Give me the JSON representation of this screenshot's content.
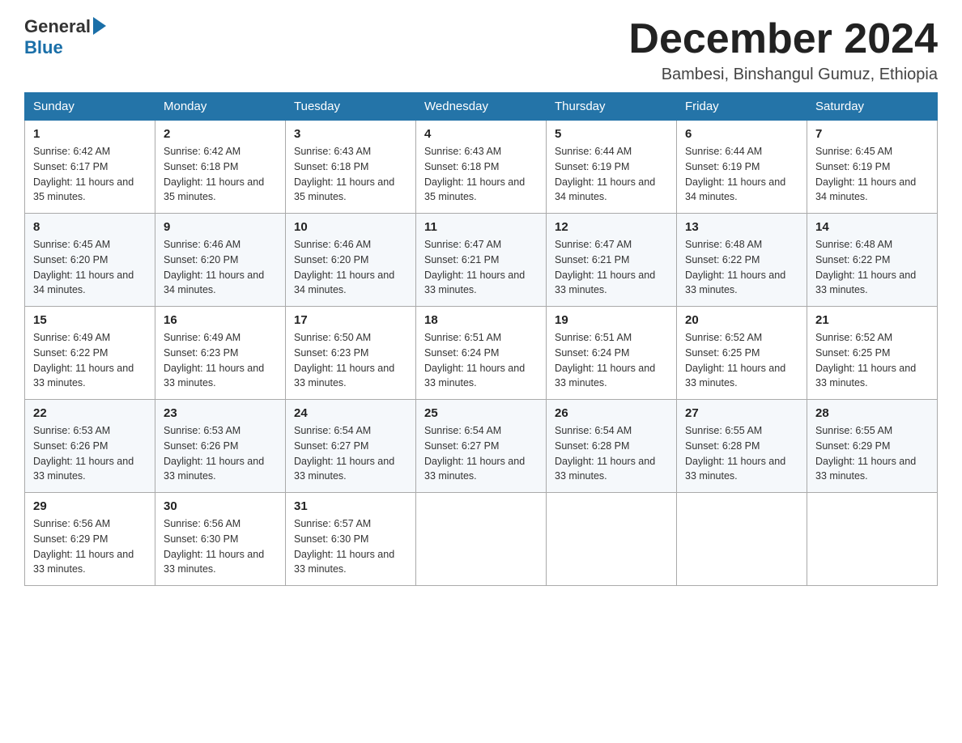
{
  "logo": {
    "general": "General",
    "blue": "Blue"
  },
  "header": {
    "month": "December 2024",
    "location": "Bambesi, Binshangul Gumuz, Ethiopia"
  },
  "weekdays": [
    "Sunday",
    "Monday",
    "Tuesday",
    "Wednesday",
    "Thursday",
    "Friday",
    "Saturday"
  ],
  "weeks": [
    [
      {
        "day": "1",
        "sunrise": "6:42 AM",
        "sunset": "6:17 PM",
        "daylight": "11 hours and 35 minutes."
      },
      {
        "day": "2",
        "sunrise": "6:42 AM",
        "sunset": "6:18 PM",
        "daylight": "11 hours and 35 minutes."
      },
      {
        "day": "3",
        "sunrise": "6:43 AM",
        "sunset": "6:18 PM",
        "daylight": "11 hours and 35 minutes."
      },
      {
        "day": "4",
        "sunrise": "6:43 AM",
        "sunset": "6:18 PM",
        "daylight": "11 hours and 35 minutes."
      },
      {
        "day": "5",
        "sunrise": "6:44 AM",
        "sunset": "6:19 PM",
        "daylight": "11 hours and 34 minutes."
      },
      {
        "day": "6",
        "sunrise": "6:44 AM",
        "sunset": "6:19 PM",
        "daylight": "11 hours and 34 minutes."
      },
      {
        "day": "7",
        "sunrise": "6:45 AM",
        "sunset": "6:19 PM",
        "daylight": "11 hours and 34 minutes."
      }
    ],
    [
      {
        "day": "8",
        "sunrise": "6:45 AM",
        "sunset": "6:20 PM",
        "daylight": "11 hours and 34 minutes."
      },
      {
        "day": "9",
        "sunrise": "6:46 AM",
        "sunset": "6:20 PM",
        "daylight": "11 hours and 34 minutes."
      },
      {
        "day": "10",
        "sunrise": "6:46 AM",
        "sunset": "6:20 PM",
        "daylight": "11 hours and 34 minutes."
      },
      {
        "day": "11",
        "sunrise": "6:47 AM",
        "sunset": "6:21 PM",
        "daylight": "11 hours and 33 minutes."
      },
      {
        "day": "12",
        "sunrise": "6:47 AM",
        "sunset": "6:21 PM",
        "daylight": "11 hours and 33 minutes."
      },
      {
        "day": "13",
        "sunrise": "6:48 AM",
        "sunset": "6:22 PM",
        "daylight": "11 hours and 33 minutes."
      },
      {
        "day": "14",
        "sunrise": "6:48 AM",
        "sunset": "6:22 PM",
        "daylight": "11 hours and 33 minutes."
      }
    ],
    [
      {
        "day": "15",
        "sunrise": "6:49 AM",
        "sunset": "6:22 PM",
        "daylight": "11 hours and 33 minutes."
      },
      {
        "day": "16",
        "sunrise": "6:49 AM",
        "sunset": "6:23 PM",
        "daylight": "11 hours and 33 minutes."
      },
      {
        "day": "17",
        "sunrise": "6:50 AM",
        "sunset": "6:23 PM",
        "daylight": "11 hours and 33 minutes."
      },
      {
        "day": "18",
        "sunrise": "6:51 AM",
        "sunset": "6:24 PM",
        "daylight": "11 hours and 33 minutes."
      },
      {
        "day": "19",
        "sunrise": "6:51 AM",
        "sunset": "6:24 PM",
        "daylight": "11 hours and 33 minutes."
      },
      {
        "day": "20",
        "sunrise": "6:52 AM",
        "sunset": "6:25 PM",
        "daylight": "11 hours and 33 minutes."
      },
      {
        "day": "21",
        "sunrise": "6:52 AM",
        "sunset": "6:25 PM",
        "daylight": "11 hours and 33 minutes."
      }
    ],
    [
      {
        "day": "22",
        "sunrise": "6:53 AM",
        "sunset": "6:26 PM",
        "daylight": "11 hours and 33 minutes."
      },
      {
        "day": "23",
        "sunrise": "6:53 AM",
        "sunset": "6:26 PM",
        "daylight": "11 hours and 33 minutes."
      },
      {
        "day": "24",
        "sunrise": "6:54 AM",
        "sunset": "6:27 PM",
        "daylight": "11 hours and 33 minutes."
      },
      {
        "day": "25",
        "sunrise": "6:54 AM",
        "sunset": "6:27 PM",
        "daylight": "11 hours and 33 minutes."
      },
      {
        "day": "26",
        "sunrise": "6:54 AM",
        "sunset": "6:28 PM",
        "daylight": "11 hours and 33 minutes."
      },
      {
        "day": "27",
        "sunrise": "6:55 AM",
        "sunset": "6:28 PM",
        "daylight": "11 hours and 33 minutes."
      },
      {
        "day": "28",
        "sunrise": "6:55 AM",
        "sunset": "6:29 PM",
        "daylight": "11 hours and 33 minutes."
      }
    ],
    [
      {
        "day": "29",
        "sunrise": "6:56 AM",
        "sunset": "6:29 PM",
        "daylight": "11 hours and 33 minutes."
      },
      {
        "day": "30",
        "sunrise": "6:56 AM",
        "sunset": "6:30 PM",
        "daylight": "11 hours and 33 minutes."
      },
      {
        "day": "31",
        "sunrise": "6:57 AM",
        "sunset": "6:30 PM",
        "daylight": "11 hours and 33 minutes."
      },
      null,
      null,
      null,
      null
    ]
  ]
}
